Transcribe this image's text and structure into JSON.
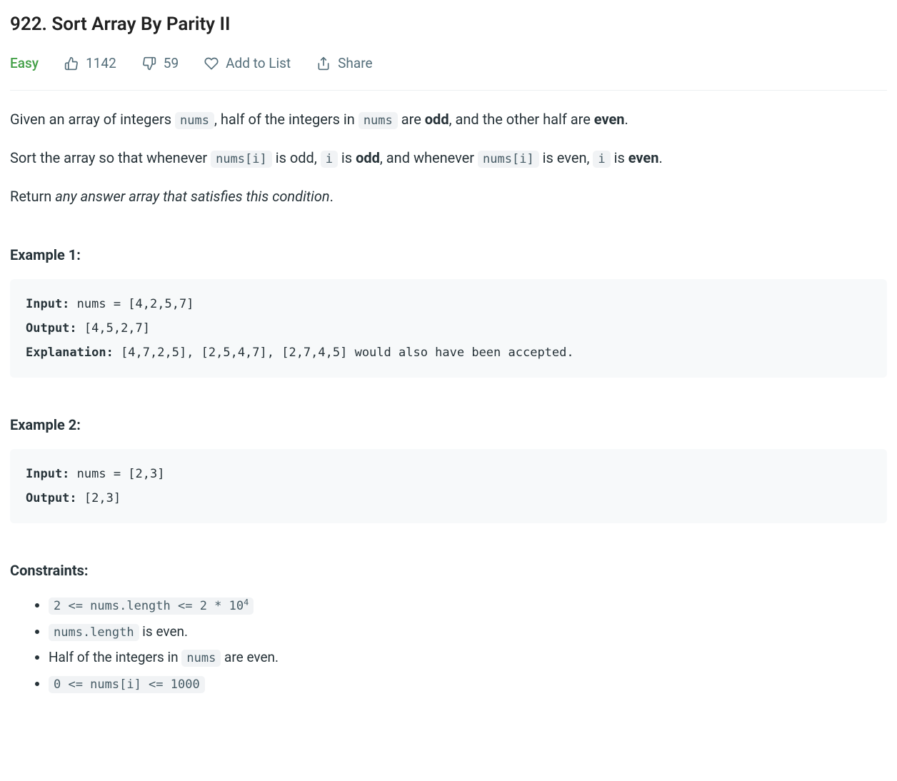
{
  "title": "922. Sort Array By Parity II",
  "meta": {
    "difficulty": "Easy",
    "likes": "1142",
    "dislikes": "59",
    "add_to_list": "Add to List",
    "share": "Share"
  },
  "desc": {
    "p1_a": "Given an array of integers ",
    "p1_code1": "nums",
    "p1_b": ", half of the integers in ",
    "p1_code2": "nums",
    "p1_c": " are ",
    "p1_bold1": "odd",
    "p1_d": ", and the other half are ",
    "p1_bold2": "even",
    "p1_e": ".",
    "p2_a": "Sort the array so that whenever ",
    "p2_code1": "nums[i]",
    "p2_b": " is odd, ",
    "p2_code2": "i",
    "p2_c": " is ",
    "p2_bold1": "odd",
    "p2_d": ", and whenever ",
    "p2_code3": "nums[i]",
    "p2_e": " is even, ",
    "p2_code4": "i",
    "p2_f": " is ",
    "p2_bold2": "even",
    "p2_g": ".",
    "p3_a": "Return ",
    "p3_em": "any answer array that satisfies this condition",
    "p3_b": "."
  },
  "examples": {
    "ex1_heading": "Example 1:",
    "ex1_input_label": "Input:",
    "ex1_input": " nums = [4,2,5,7]",
    "ex1_output_label": "Output:",
    "ex1_output": " [4,5,2,7]",
    "ex1_expl_label": "Explanation:",
    "ex1_expl": " [4,7,2,5], [2,5,4,7], [2,7,4,5] would also have been accepted.",
    "ex2_heading": "Example 2:",
    "ex2_input_label": "Input:",
    "ex2_input": " nums = [2,3]",
    "ex2_output_label": "Output:",
    "ex2_output": " [2,3]"
  },
  "constraints": {
    "heading": "Constraints:",
    "c1_a": "2 <= nums.length <= 2 * 10",
    "c1_sup": "4",
    "c2_code": "nums.length",
    "c2_text": " is even.",
    "c3_a": "Half of the integers in ",
    "c3_code": "nums",
    "c3_b": " are even.",
    "c4": "0 <= nums[i] <= 1000"
  }
}
